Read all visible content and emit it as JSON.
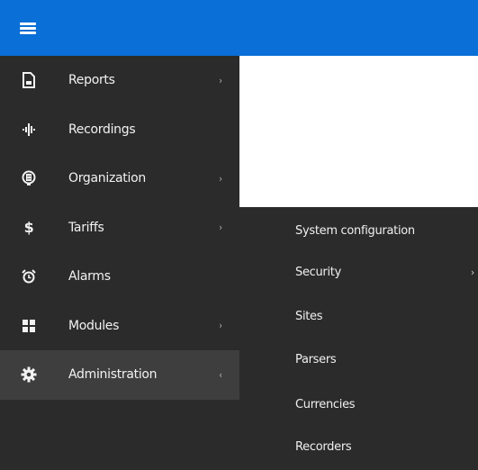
{
  "header": {
    "menu_icon": "hamburger-icon",
    "accent_color": "#0a6fd6"
  },
  "sidebar": {
    "background": "#2b2b2b",
    "items": [
      {
        "label": "Reports",
        "icon": "report-icon",
        "has_submenu": true,
        "chevron": "›"
      },
      {
        "label": "Recordings",
        "icon": "waveform-icon",
        "has_submenu": false,
        "chevron": ""
      },
      {
        "label": "Organization",
        "icon": "organization-icon",
        "has_submenu": true,
        "chevron": "›"
      },
      {
        "label": "Tariffs",
        "icon": "dollar-icon",
        "has_submenu": true,
        "chevron": "›"
      },
      {
        "label": "Alarms",
        "icon": "alarm-clock-icon",
        "has_submenu": false,
        "chevron": ""
      },
      {
        "label": "Modules",
        "icon": "modules-icon",
        "has_submenu": true,
        "chevron": "›"
      },
      {
        "label": "Administration",
        "icon": "gear-icon",
        "has_submenu": true,
        "chevron": "‹",
        "active": true
      }
    ]
  },
  "submenu": {
    "parent": "Administration",
    "items": [
      {
        "label": "System configuration",
        "chevron": ""
      },
      {
        "label": "Security",
        "chevron": "›"
      },
      {
        "label": "Sites",
        "chevron": ""
      },
      {
        "label": "Parsers",
        "chevron": ""
      },
      {
        "label": "Currencies",
        "chevron": ""
      },
      {
        "label": "Recorders",
        "chevron": ""
      }
    ]
  }
}
